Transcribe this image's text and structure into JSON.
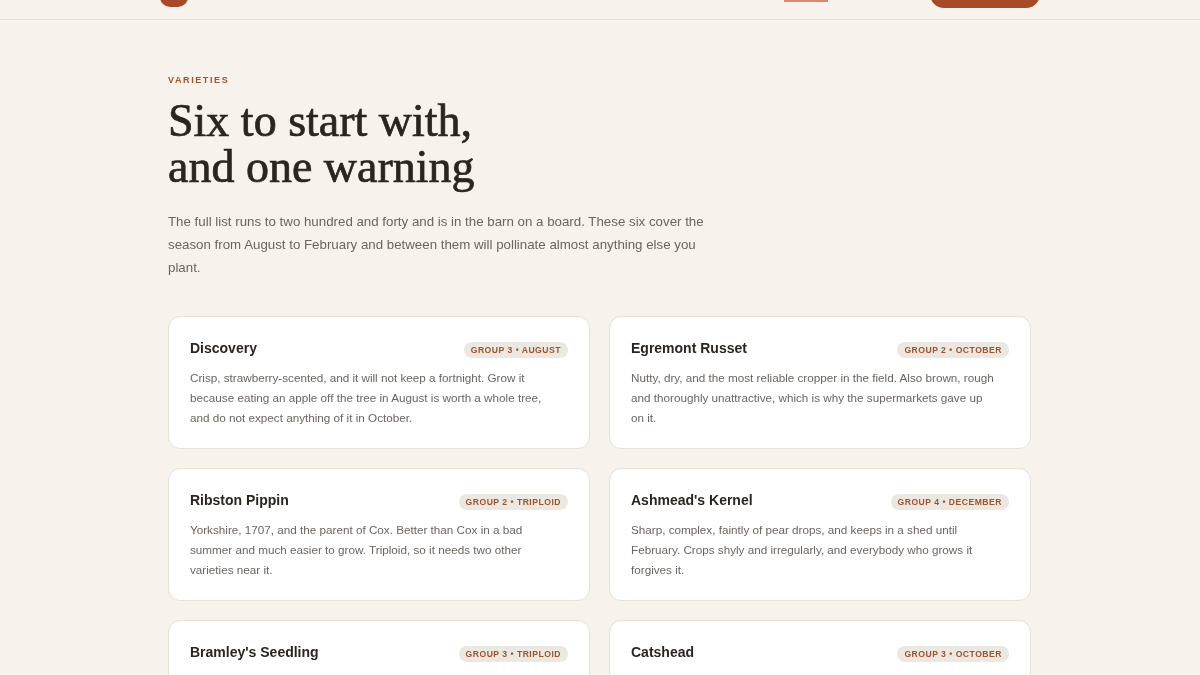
{
  "section": {
    "eyebrow": "VARIETIES",
    "title_lines": [
      "Six to start with,",
      "and one warning"
    ],
    "intro": "The full list runs to two hundred and forty and is in the barn on a board. These six cover the season from August to February and between them will pollinate almost anything else you plant."
  },
  "varieties": [
    {
      "name": "Discovery",
      "badge": "GROUP 3 • AUGUST",
      "description": "Crisp, strawberry-scented, and it will not keep a fortnight. Grow it because eating an apple off the tree in August is worth a whole tree, and do not expect anything of it in October."
    },
    {
      "name": "Egremont Russet",
      "badge": "GROUP 2 • OCTOBER",
      "description": "Nutty, dry, and the most reliable cropper in the field. Also brown, rough and thoroughly unattractive, which is why the supermarkets gave up on it."
    },
    {
      "name": "Ribston Pippin",
      "badge": "GROUP 2 • TRIPLOID",
      "description": "Yorkshire, 1707, and the parent of Cox. Better than Cox in a bad summer and much easier to grow. Triploid, so it needs two other varieties near it."
    },
    {
      "name": "Ashmead's Kernel",
      "badge": "GROUP 4 • DECEMBER",
      "description": "Sharp, complex, faintly of pear drops, and keeps in a shed until February. Crops shyly and irregularly, and everybody who grows it forgives it."
    },
    {
      "name": "Bramley's Seedling",
      "badge": "GROUP 3 • TRIPLOID"
    },
    {
      "name": "Catshead",
      "badge": "GROUP 3 • OCTOBER"
    }
  ]
}
